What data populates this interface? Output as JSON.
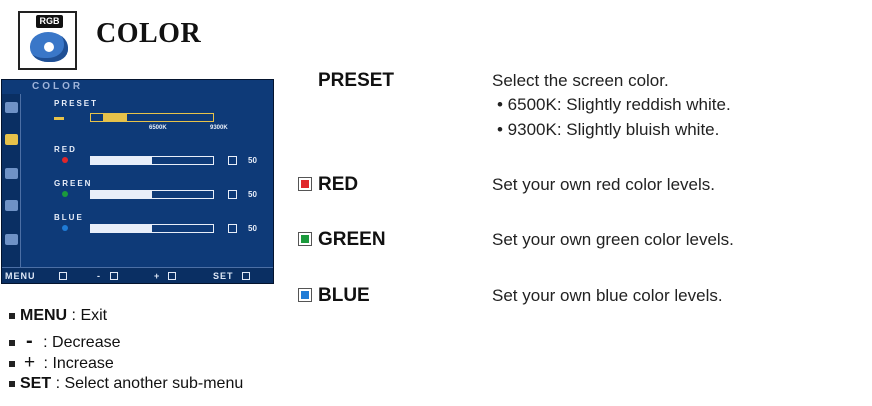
{
  "header": {
    "icon_label": "RGB",
    "icon_name": "color-palette-icon",
    "title": "COLOR"
  },
  "osd": {
    "title": "COLOR",
    "preset_label": "PRESET",
    "preset_tick_left": "6500K",
    "preset_tick_right": "9300K",
    "red_label": "RED",
    "red_value": "50",
    "green_label": "GREEN",
    "green_value": "50",
    "blue_label": "BLUE",
    "blue_value": "50",
    "slider_level": 0.5,
    "footer_menu": "MENU",
    "footer_minus": "-",
    "footer_plus": "+",
    "footer_set": "SET"
  },
  "items": {
    "preset": {
      "term": "PRESET",
      "desc": "Select the screen color.",
      "opt1": "• 6500K: Slightly reddish white.",
      "opt2": "• 9300K: Slightly bluish white."
    },
    "red": {
      "term": "RED",
      "desc": "Set your own red color levels.",
      "color": "#e0262a"
    },
    "green": {
      "term": "GREEN",
      "desc": "Set your own green color levels.",
      "color": "#1b9a3c"
    },
    "blue": {
      "term": "BLUE",
      "desc": "Set your own blue color levels.",
      "color": "#1f7bd6"
    }
  },
  "legend": {
    "menu_key": "MENU",
    "menu_desc": " : Exit",
    "minus_key": "-",
    "minus_desc": " : Decrease",
    "plus_key": "+",
    "plus_desc": " : Increase",
    "set_key": "SET",
    "set_desc": " : Select another sub-menu"
  }
}
